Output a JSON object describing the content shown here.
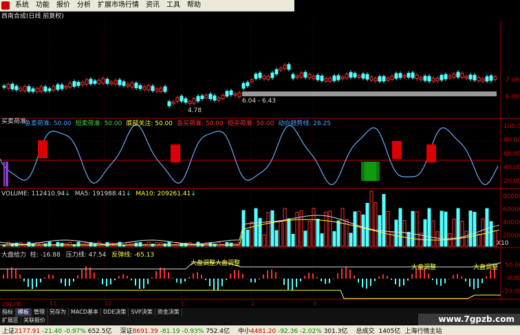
{
  "menu": {
    "items": [
      "系统",
      "功能",
      "报价",
      "分析",
      "扩展市场行情",
      "资讯",
      "工具",
      "帮助"
    ]
  },
  "stock_title": "西南合成(日线 前复权)",
  "price_panel": {
    "right_axis": [
      "7.00",
      "6.00"
    ],
    "range_label": "6.04 - 6.43",
    "low_label": "4.78"
  },
  "indicator1": {
    "name": "买卖荷准:",
    "items": [
      {
        "label": "急卖荷准:",
        "value": "50.00",
        "color": "#4aa0ff"
      },
      {
        "label": "短卖荷准:",
        "value": "50.00",
        "color": "#3fd93f"
      },
      {
        "label": "底部关注:",
        "value": "50.00",
        "color": "#ffff40"
      },
      {
        "label": "急买荷准:",
        "value": "50.00",
        "color": "#ff3030"
      },
      {
        "label": "短买荷准:",
        "value": "50.00",
        "color": "#ff3030"
      },
      {
        "label": "动向趋势线:",
        "value": "28.25",
        "color": "#4aa0ff"
      }
    ],
    "right_axis": [
      "100.00",
      "80.00",
      "60.00",
      "40.00",
      "20.00"
    ]
  },
  "volume": {
    "label": "VOLUME:",
    "vol": "112410.94",
    "ma5_label": "MA5:",
    "ma5": "191988.41",
    "ma10_label": "MA10:",
    "ma10": "209261.41",
    "right_axis": [
      "80000",
      "60000",
      "40000",
      "20000"
    ],
    "unit": "X10"
  },
  "dapan": {
    "label": "大盘给力",
    "zhu_label": "柱:",
    "zhu": "-16.88",
    "yali_label": "压力线:",
    "yali": "47.54",
    "fantan_label": "反弹线:",
    "fantan": "-65.13",
    "right_axis": [
      "50.00",
      "0.00",
      "-50.00"
    ],
    "tags": [
      "大盘调整",
      "大盘调整",
      "大盘调整",
      "大盘调整"
    ]
  },
  "x_axis": [
    "2012年",
    "11",
    "12",
    "1",
    "2",
    "3"
  ],
  "tabs_row1": [
    "指标",
    "模板",
    "管理",
    "另存为",
    "MACD基本",
    "DDE决策",
    "SVP决策",
    "资金决策"
  ],
  "tabs_row1_active": "模板",
  "tabs_row2": [
    "扩展区",
    "关联报价"
  ],
  "watermark": "www.7gpzb.com",
  "status": [
    {
      "name": "上证",
      "value": "2177.91",
      "chg": "-21.40",
      "pct": "-0.97%",
      "amt": "652.5亿"
    },
    {
      "name": "深证",
      "value": "8691.39",
      "chg": "-81.19",
      "pct": "-0.93%",
      "amt": "752.4亿"
    },
    {
      "name": "中小",
      "value": "4481.20",
      "chg": "-92.36",
      "pct": "-2.02%",
      "amt": "301.3亿"
    }
  ],
  "status_extra": [
    "总成交",
    "1405亿",
    "上海行情主站"
  ],
  "colors": {
    "up": "#ff3030",
    "down": "#54ffff",
    "grid": "#880000",
    "accent": "#ffff40"
  }
}
